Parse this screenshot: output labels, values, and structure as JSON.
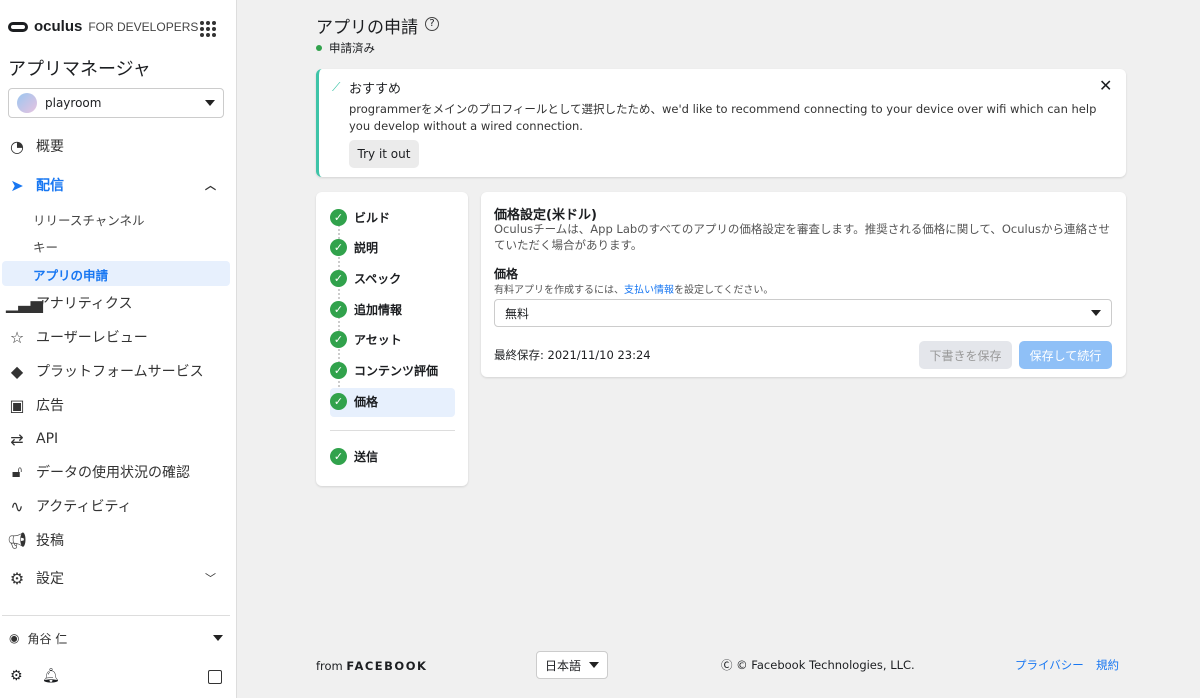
{
  "sidebar": {
    "logo_brand": "oculus",
    "logo_suffix": "FOR DEVELOPERS",
    "title": "アプリマネージャ",
    "app": "playroom",
    "items": [
      {
        "label": "概要",
        "icon": "dashboard-icon"
      },
      {
        "label": "配信",
        "icon": "paper-plane-icon"
      },
      {
        "label": "アナリティクス",
        "icon": "bar-chart-icon"
      },
      {
        "label": "ユーザーレビュー",
        "icon": "star-icon"
      },
      {
        "label": "プラットフォームサービス",
        "icon": "layers-icon"
      },
      {
        "label": "広告",
        "icon": "ads-icon"
      },
      {
        "label": "API",
        "icon": "swap-arrows-icon"
      },
      {
        "label": "データの使用状況の確認",
        "icon": "lock-heart-icon"
      },
      {
        "label": "アクティビティ",
        "icon": "pulse-icon"
      },
      {
        "label": "投稿",
        "icon": "megaphone-icon"
      },
      {
        "label": "設定",
        "icon": "gear-icon"
      }
    ],
    "subitems": [
      "リリースチャンネル",
      "キー",
      "アプリの申請"
    ],
    "user": "角谷 仁"
  },
  "page": {
    "title": "アプリの申請",
    "status": "申請済み",
    "status_color": "#31a24c"
  },
  "recommendation": {
    "title": "おすすめ",
    "text": "programmerをメインのプロフィールとして選択したため、we'd like to recommend connecting to your device over wifi which can help you develop without a wired connection.",
    "button": "Try it out"
  },
  "steps": [
    "ビルド",
    "説明",
    "スペック",
    "追加情報",
    "アセット",
    "コンテンツ評価",
    "価格",
    "送信"
  ],
  "pricing": {
    "title": "価格設定(米ドル)",
    "desc": "Oculusチームは、App Labのすべてのアプリの価格設定を審査します。推奨される価格に関して、Oculusから連絡させていただく場合があります。",
    "label": "価格",
    "hint_pre": "有料アプリを作成するには、",
    "hint_link": "支払い情報",
    "hint_post": "を設定してください。",
    "value": "無料",
    "last_saved": "最終保存: 2021/11/10 23:24",
    "save_draft": "下書きを保存",
    "save_continue": "保存して続行"
  },
  "footer": {
    "from": "from",
    "brand": "FACEBOOK",
    "language": "日本語",
    "copyright": "© Facebook Technologies, LLC.",
    "privacy": "プライバシー",
    "terms": "規約"
  }
}
